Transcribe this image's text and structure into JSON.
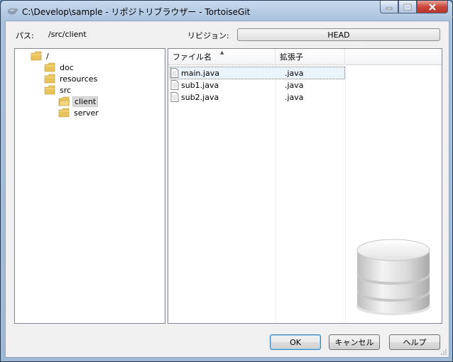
{
  "window": {
    "title": "C:\\Develop\\sample - リポジトリブラウザー - TortoiseGit",
    "minimize_glyph": "—",
    "maximize_glyph": "□",
    "close_glyph": "X"
  },
  "path_row": {
    "label": "パス:",
    "value": "/src/client"
  },
  "revision_row": {
    "label": "リビジョン:",
    "button": "HEAD"
  },
  "tree": {
    "nodes": [
      {
        "label": "/",
        "level": 0
      },
      {
        "label": "doc",
        "level": 1
      },
      {
        "label": "resources",
        "level": 1
      },
      {
        "label": "src",
        "level": 1
      },
      {
        "label": "client",
        "level": 2,
        "selected": true
      },
      {
        "label": "server",
        "level": 2
      }
    ]
  },
  "list": {
    "columns": [
      "ファイル名",
      "拡張子"
    ],
    "rows": [
      {
        "name": "main.java",
        "ext": ".java",
        "focused": true
      },
      {
        "name": "sub1.java",
        "ext": ".java"
      },
      {
        "name": "sub2.java",
        "ext": ".java"
      }
    ]
  },
  "buttons": {
    "ok": "OK",
    "cancel": "キャンセル",
    "help": "ヘルプ"
  },
  "icons": {
    "app": "tortoise-icon",
    "folder": "folder-icon",
    "file": "file-icon",
    "database": "database-icon"
  },
  "colors": {
    "folder": "#e8c25a",
    "title_bar": "#a9c1dd",
    "close_button": "#c9463a"
  }
}
